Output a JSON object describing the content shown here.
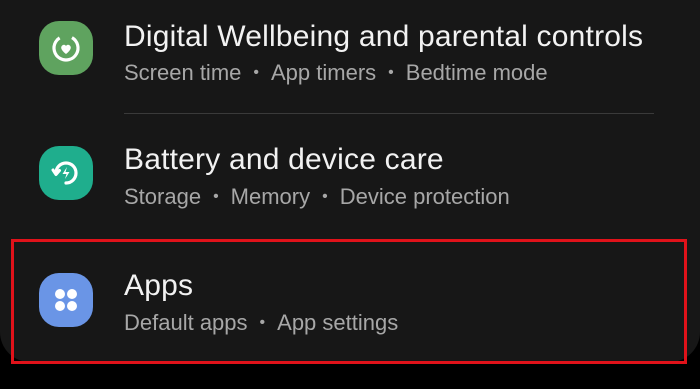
{
  "settings_list": {
    "items": [
      {
        "title": "Digital Wellbeing and parental controls",
        "subtitles": [
          "Screen time",
          "App timers",
          "Bedtime mode"
        ],
        "icon": "digital-wellbeing-icon",
        "icon_color": "#5fa35f"
      },
      {
        "title": "Battery and device care",
        "subtitles": [
          "Storage",
          "Memory",
          "Device protection"
        ],
        "icon": "device-care-icon",
        "icon_color": "#1fae8d"
      },
      {
        "title": "Apps",
        "subtitles": [
          "Default apps",
          "App settings"
        ],
        "icon": "apps-icon",
        "icon_color": "#6a95e6"
      }
    ],
    "separator": "•"
  },
  "colors": {
    "background": "#000000",
    "card": "#171717",
    "title_text": "#f2f2f2",
    "subtitle_text": "#a7a7a7",
    "highlight_border": "#e0121a"
  }
}
